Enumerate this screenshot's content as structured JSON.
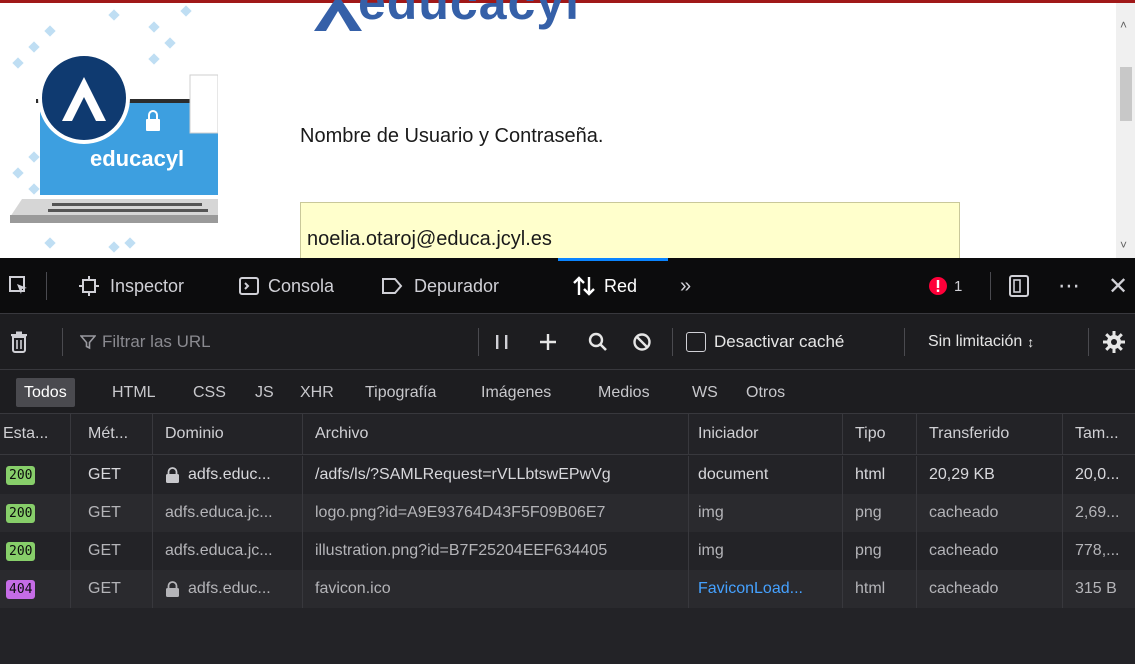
{
  "webpage": {
    "brand_text": "educacyl",
    "illustration_brand": "educacyl",
    "login_heading": "Nombre de Usuario y Contraseña.",
    "username_value": "noelia.otaroj@educa.jcyl.es",
    "colors": {
      "brand": "#3560a8",
      "input_bg": "#ffffcc",
      "top_border": "#a01818"
    }
  },
  "devtools": {
    "toolbox": {
      "picker_icon": "element-picker-icon",
      "tabs": [
        {
          "label": "Inspector",
          "icon": "inspector-icon"
        },
        {
          "label": "Consola",
          "icon": "console-icon"
        },
        {
          "label": "Depurador",
          "icon": "debugger-icon"
        },
        {
          "label": "Red",
          "icon": "network-icon",
          "active": true
        }
      ],
      "overflow_icon": "chevron-double-right-icon",
      "error_count": "1",
      "colors": {
        "error": "#ff0039",
        "active_tab": "#0a84ff"
      }
    },
    "net_toolbar": {
      "filter_placeholder": "Filtrar las URL",
      "disable_cache_label": "Desactivar caché",
      "throttling_label": "Sin limitación",
      "throttling_arrow": "↕"
    },
    "type_filters": [
      "Todos",
      "HTML",
      "CSS",
      "JS",
      "XHR",
      "Tipografía",
      "Imágenes",
      "Medios",
      "WS",
      "Otros"
    ],
    "table": {
      "columns": [
        "Esta...",
        "Mét...",
        "Dominio",
        "Archivo",
        "Iniciador",
        "Tipo",
        "Transferido",
        "Tam..."
      ],
      "rows": [
        {
          "status": "200",
          "method": "GET",
          "domain": "adfs.educ...",
          "secure": true,
          "file": "/adfs/ls/?SAMLRequest=rVLLbtswEPwVg",
          "initiator": "document",
          "type": "html",
          "transferred": "20,29 KB",
          "size": "20,0...",
          "status_color": "#87ce6a"
        },
        {
          "status": "200",
          "method": "GET",
          "domain": "adfs.educa.jc...",
          "secure": false,
          "file": "logo.png?id=A9E93764D43F5F09B06E7",
          "initiator": "img",
          "type": "png",
          "transferred": "cacheado",
          "size": "2,69...",
          "status_color": "#87ce6a"
        },
        {
          "status": "200",
          "method": "GET",
          "domain": "adfs.educa.jc...",
          "secure": false,
          "file": "illustration.png?id=B7F25204EEF634405",
          "initiator": "img",
          "type": "png",
          "transferred": "cacheado",
          "size": "778,...",
          "status_color": "#87ce6a"
        },
        {
          "status": "404",
          "method": "GET",
          "domain": "adfs.educ...",
          "secure": true,
          "file": "favicon.ico",
          "initiator": "FaviconLoad...",
          "type": "html",
          "transferred": "cacheado",
          "size": "315 B",
          "status_color": "#c56ce6"
        }
      ]
    }
  }
}
